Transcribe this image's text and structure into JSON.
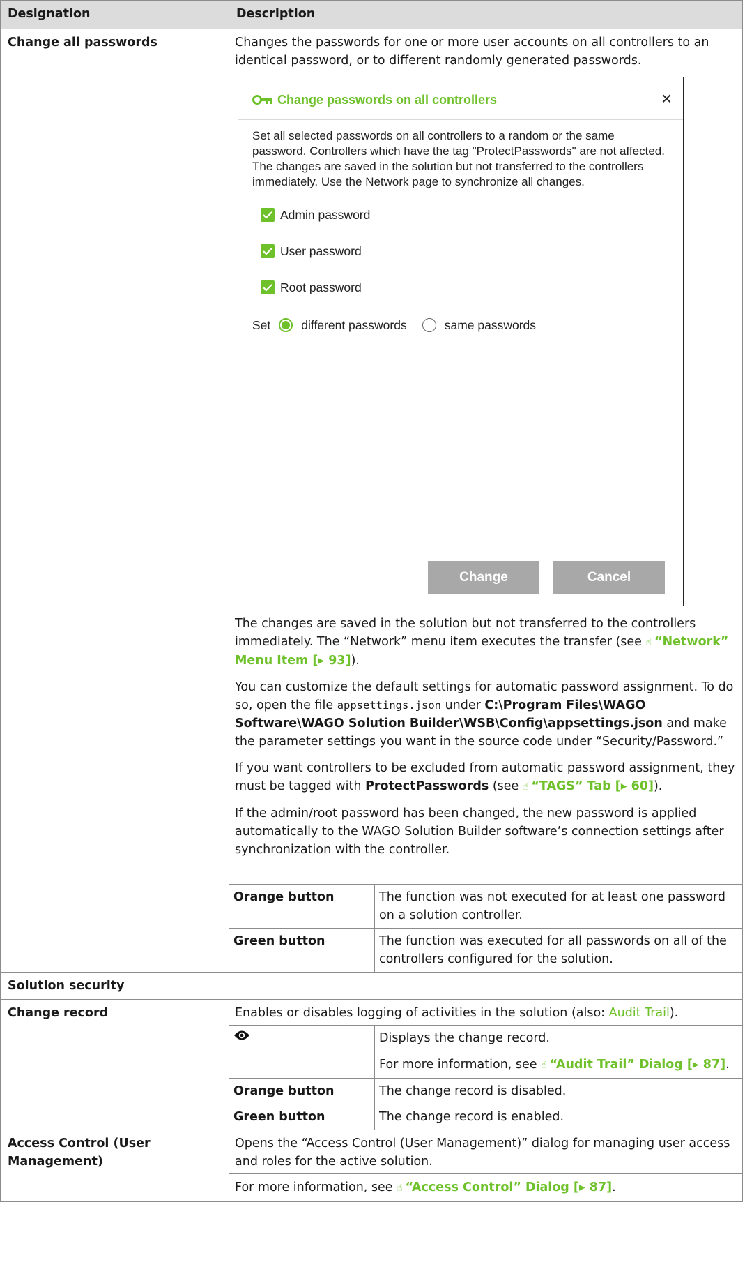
{
  "header": {
    "col1": "Designation",
    "col2": "Description"
  },
  "change_all": {
    "designation": "Change all passwords",
    "intro": "Changes the passwords for one or more user accounts on all controllers to an identical password, or to different randomly generated passwords.",
    "dialog": {
      "title": "Change passwords on all controllers",
      "text1": "Set all selected passwords on all controllers to a random or the same password. Controllers which have the tag \"ProtectPasswords\" are not affected.",
      "text2": "The changes are saved in the solution but not transferred to the controllers immediately. Use the Network page to synchronize all changes.",
      "checkbox_admin": "Admin password",
      "checkbox_user": "User password",
      "checkbox_root": "Root password",
      "set_label": "Set",
      "radio_different": "different passwords",
      "radio_same": "same passwords",
      "change_button": "Change",
      "cancel_button": "Cancel"
    },
    "p1_text": "The changes are saved in the solution but not transferred to the controllers immediately. The “Network” menu item executes the transfer (see ",
    "p1_link": "“Network” Menu Item [▸ 93]",
    "p1_end": ").",
    "p2_a": "You can customize the default settings for automatic password assignment. To do so, open the file ",
    "p2_code": "appsettings.json",
    "p2_b": " under ",
    "p2_path": "C:\\Program Files\\WAGO Software\\WAGO Solution Builder\\WSB\\Config\\appsettings.json",
    "p2_c": " and make the parameter settings you want in the source code under “Security/Password.”",
    "p3_a": "If you want controllers to be excluded from automatic password assignment, they must be tagged with ",
    "p3_bold": "ProtectPasswords",
    "p3_b": " (see ",
    "p3_link": "“TAGS” Tab [▸ 60]",
    "p3_end": ").",
    "p4": "If the admin/root password has been changed, the new password is applied automatically to the WAGO Solution Builder software’s connection settings after synchronization with the controller.",
    "orange_label": "Orange button",
    "orange_text": "The function was not executed for at least one password on a solution controller.",
    "green_label": "Green button",
    "green_text": "The function was executed for all passwords on all of the controllers configured for the solution."
  },
  "solution_security": {
    "label": "Solution security"
  },
  "change_record": {
    "designation": "Change record",
    "intro_a": "Enables or disables logging of activities in the solution (also: ",
    "intro_link": "Audit Trail",
    "intro_end": ").",
    "eye_text": "Displays the change record.",
    "eye_more_a": "For more information, see ",
    "eye_more_link": "“Audit Trail” Dialog [▸ 87]",
    "eye_more_end": ".",
    "orange_label": "Orange button",
    "orange_text": "The change record is disabled.",
    "green_label": "Green button",
    "green_text": "The change record is enabled."
  },
  "access_control": {
    "designation": "Access Control (User Management)",
    "intro": "Opens the “Access Control (User Management)” dialog for managing user access and roles for the active solution.",
    "more_a": "For more information, see ",
    "more_link": "“Access Control” Dialog [▸ 87]",
    "more_end": "."
  },
  "colors": {
    "accent": "#6ec12a",
    "header_bg": "#dcdcdc",
    "button_gray": "#a8a8a8"
  },
  "icons": [
    "key-icon",
    "close-icon",
    "check-icon",
    "radio-icon",
    "eye-icon",
    "link-hand-icon"
  ]
}
